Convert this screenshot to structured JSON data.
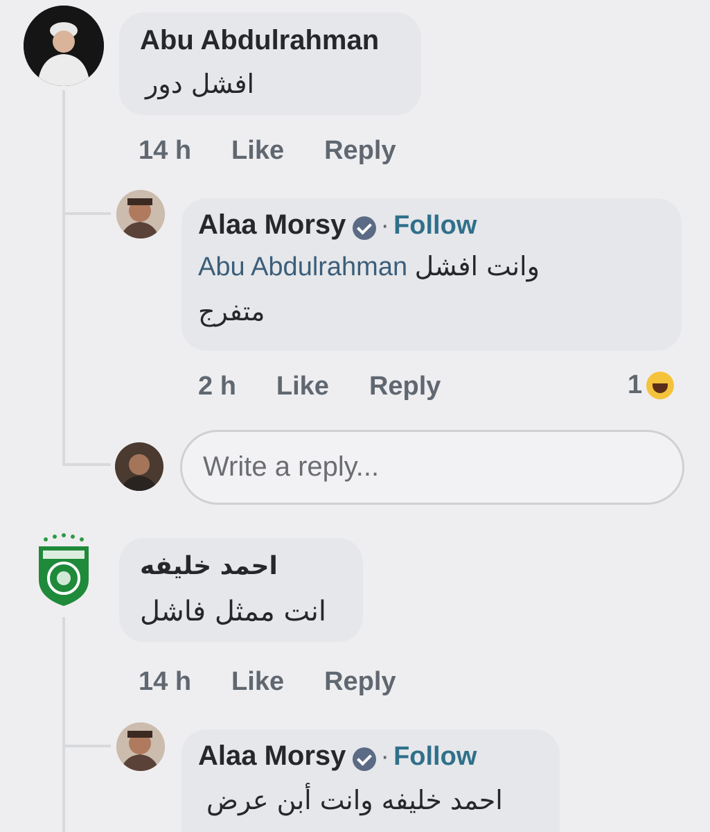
{
  "comments": [
    {
      "author": "Abu Abdulrahman",
      "text": "افشل دور",
      "time": "14 h",
      "like_label": "Like",
      "reply_label": "Reply",
      "replies": [
        {
          "author": "Alaa Morsy",
          "verified": true,
          "follow_label": "Follow",
          "mention": "Abu Abdulrahman",
          "text_line1": "وانت افشل",
          "text_line2": "متفرج",
          "time": "2 h",
          "like_label": "Like",
          "reply_label": "Reply",
          "reaction_count": "1",
          "reaction_icon": "haha-emoji"
        }
      ],
      "reply_input_placeholder": "Write a reply..."
    },
    {
      "author": "احمد خليفه",
      "text": "انت ممثل فاشل",
      "time": "14 h",
      "like_label": "Like",
      "reply_label": "Reply",
      "replies": [
        {
          "author": "Alaa Morsy",
          "verified": true,
          "follow_label": "Follow",
          "text": "احمد خليفه وانت أبن عرض"
        }
      ]
    }
  ],
  "colors": {
    "background": "#eeeef0",
    "bubble": "#e6e7ea",
    "follow": "#30708a",
    "meta": "#606770",
    "verified_badge": "#5b6b85"
  }
}
